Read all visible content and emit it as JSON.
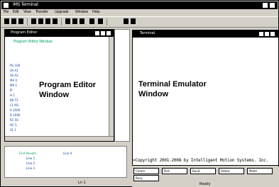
{
  "app": {
    "title": "IMS Terminal"
  },
  "menu": {
    "items": [
      "File",
      "Edit",
      "View",
      "Transfer",
      "Upgrade",
      "Window",
      "Help"
    ]
  },
  "editor": {
    "title": "Program Editor",
    "header": "Program Editor Window",
    "label_line1": "Program Editor",
    "label_line2": "Window",
    "code_lines": [
      "PG 100",
      "VA A1",
      "VA A2",
      "MA 0",
      "MR 1",
      "IP",
      "H 1",
      "BR T1",
      "CL M1",
      "A 1000",
      "D 1000",
      "RC 50",
      "HC 5",
      "S1 1"
    ]
  },
  "terminal": {
    "title": "Terminal",
    "label_line1": "Terminal Emulator",
    "label_line2": "Window",
    "copyright": ">Copyright 2001-2008 by Intelligent Motion Systems. Inc.",
    "status_panels": [
      "Comm",
      "Port",
      "Baud",
      "Status",
      "Mode",
      "Busy"
    ]
  },
  "bottom_pane": {
    "title": "Find Results",
    "items": [
      "Line 1",
      "Line 2",
      "Line 3",
      "Line 4"
    ]
  },
  "status": {
    "left_text": "Ln 1",
    "bottom_text": "Ready"
  }
}
